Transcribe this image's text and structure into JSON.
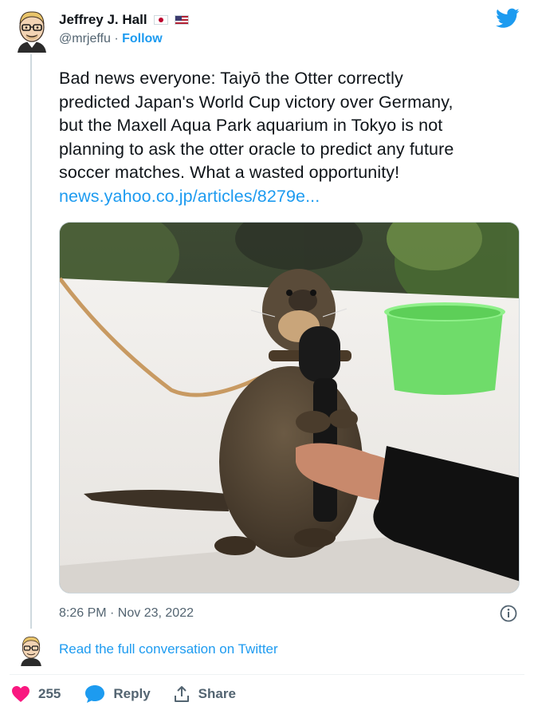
{
  "author": {
    "display_name": "Jeffrey J. Hall",
    "handle": "@mrjeffu",
    "separator": "·",
    "follow_label": "Follow",
    "flags": [
      "flag-japan-icon",
      "flag-usa-icon"
    ]
  },
  "tweet": {
    "lines": [
      "Bad news everyone: Taiyō the Otter correctly",
      "predicted Japan's World Cup victory over Germany,",
      "but the Maxell Aqua Park aquarium in Tokyo is not",
      "planning to ask the otter oracle to predict any future",
      "soccer matches. What a wasted opportunity!"
    ],
    "link_text": "news.yahoo.co.jp/articles/8279e...",
    "timestamp": "8:26 PM · Nov 23, 2022"
  },
  "media": {
    "icon": "otter-photo",
    "subject": "otter holding microphone"
  },
  "conversation_link": "Read the full conversation on Twitter",
  "actions": {
    "like_count": "255",
    "reply_label": "Reply",
    "share_label": "Share"
  },
  "colors": {
    "accent": "#1d9bf0",
    "like": "#f91880",
    "text_secondary": "#536471"
  }
}
